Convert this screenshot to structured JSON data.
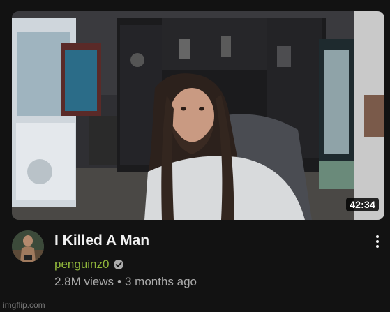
{
  "video": {
    "duration": "42:34",
    "title": "I Killed A Man",
    "channel": "penguinz0",
    "views": "2.8M views",
    "separator": "•",
    "age": "3 months ago"
  },
  "icons": {
    "verified": "verified-check-icon",
    "more": "vertical-ellipsis-icon"
  },
  "colors": {
    "background": "#121212",
    "title": "#f1f1f1",
    "channel": "#8fb63a",
    "stats": "#aaaaaa"
  },
  "watermark": "imgflip.com"
}
